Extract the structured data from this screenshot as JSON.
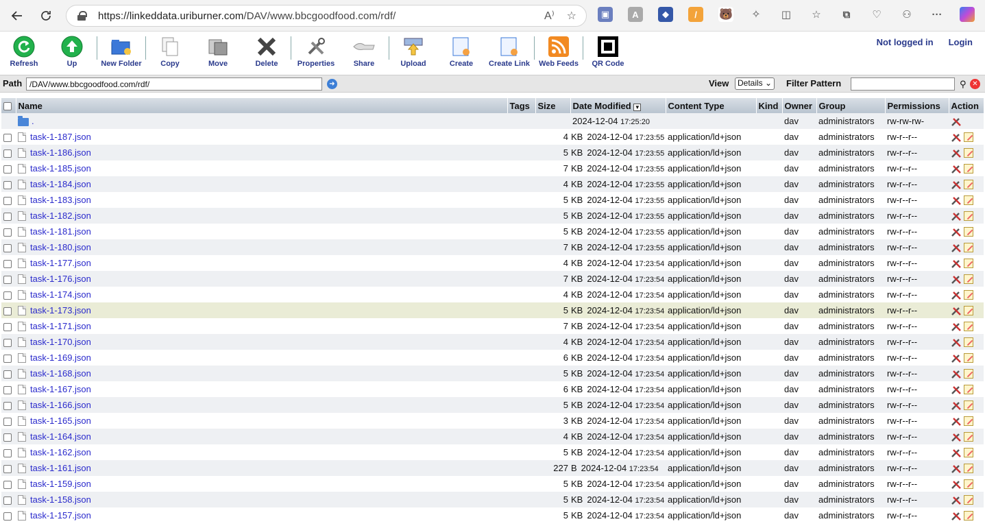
{
  "browser": {
    "url_host": "https://linkeddata.uriburner.com",
    "url_path": "/DAV/www.bbcgoodfood.com/rdf/"
  },
  "toolbar": {
    "items": [
      {
        "label": "Refresh",
        "icon": "refresh-icon"
      },
      {
        "label": "Up",
        "icon": "up-arrow-icon"
      },
      {
        "label": "New Folder",
        "icon": "new-folder-icon"
      },
      {
        "label": "Copy",
        "icon": "copy-icon"
      },
      {
        "label": "Move",
        "icon": "move-icon"
      },
      {
        "label": "Delete",
        "icon": "delete-icon"
      },
      {
        "label": "Properties",
        "icon": "properties-icon"
      },
      {
        "label": "Share",
        "icon": "share-icon"
      },
      {
        "label": "Upload",
        "icon": "upload-icon"
      },
      {
        "label": "Create",
        "icon": "create-icon"
      },
      {
        "label": "Create Link",
        "icon": "create-link-icon"
      },
      {
        "label": "Web Feeds",
        "icon": "rss-icon"
      },
      {
        "label": "QR Code",
        "icon": "qr-code-icon"
      }
    ],
    "login_status": "Not logged in",
    "login_link": "Login"
  },
  "pathbar": {
    "path_label": "Path",
    "path_value": "/DAV/www.bbcgoodfood.com/rdf/",
    "view_label": "View",
    "view_selected": "Details",
    "filter_label": "Filter Pattern",
    "filter_value": ""
  },
  "table": {
    "columns": [
      "Name",
      "Tags",
      "Size",
      "Date Modified",
      "Content Type",
      "Kind",
      "Owner",
      "Group",
      "Permissions",
      "Action"
    ],
    "parent_row": {
      "name": ".",
      "date": "2024-12-04",
      "time": "17:25:20",
      "owner": "dav",
      "group": "administrators",
      "permissions": "rw-rw-rw-"
    },
    "rows": [
      {
        "name": "task-1-187.json",
        "size_n": "4",
        "size_u": "KB",
        "date": "2024-12-04",
        "time": "17:23:55",
        "type": "application/ld+json",
        "owner": "dav",
        "group": "administrators",
        "perm": "rw-r--r--"
      },
      {
        "name": "task-1-186.json",
        "size_n": "5",
        "size_u": "KB",
        "date": "2024-12-04",
        "time": "17:23:55",
        "type": "application/ld+json",
        "owner": "dav",
        "group": "administrators",
        "perm": "rw-r--r--"
      },
      {
        "name": "task-1-185.json",
        "size_n": "7",
        "size_u": "KB",
        "date": "2024-12-04",
        "time": "17:23:55",
        "type": "application/ld+json",
        "owner": "dav",
        "group": "administrators",
        "perm": "rw-r--r--"
      },
      {
        "name": "task-1-184.json",
        "size_n": "4",
        "size_u": "KB",
        "date": "2024-12-04",
        "time": "17:23:55",
        "type": "application/ld+json",
        "owner": "dav",
        "group": "administrators",
        "perm": "rw-r--r--"
      },
      {
        "name": "task-1-183.json",
        "size_n": "5",
        "size_u": "KB",
        "date": "2024-12-04",
        "time": "17:23:55",
        "type": "application/ld+json",
        "owner": "dav",
        "group": "administrators",
        "perm": "rw-r--r--"
      },
      {
        "name": "task-1-182.json",
        "size_n": "5",
        "size_u": "KB",
        "date": "2024-12-04",
        "time": "17:23:55",
        "type": "application/ld+json",
        "owner": "dav",
        "group": "administrators",
        "perm": "rw-r--r--"
      },
      {
        "name": "task-1-181.json",
        "size_n": "5",
        "size_u": "KB",
        "date": "2024-12-04",
        "time": "17:23:55",
        "type": "application/ld+json",
        "owner": "dav",
        "group": "administrators",
        "perm": "rw-r--r--"
      },
      {
        "name": "task-1-180.json",
        "size_n": "7",
        "size_u": "KB",
        "date": "2024-12-04",
        "time": "17:23:55",
        "type": "application/ld+json",
        "owner": "dav",
        "group": "administrators",
        "perm": "rw-r--r--"
      },
      {
        "name": "task-1-177.json",
        "size_n": "4",
        "size_u": "KB",
        "date": "2024-12-04",
        "time": "17:23:54",
        "type": "application/ld+json",
        "owner": "dav",
        "group": "administrators",
        "perm": "rw-r--r--"
      },
      {
        "name": "task-1-176.json",
        "size_n": "7",
        "size_u": "KB",
        "date": "2024-12-04",
        "time": "17:23:54",
        "type": "application/ld+json",
        "owner": "dav",
        "group": "administrators",
        "perm": "rw-r--r--"
      },
      {
        "name": "task-1-174.json",
        "size_n": "4",
        "size_u": "KB",
        "date": "2024-12-04",
        "time": "17:23:54",
        "type": "application/ld+json",
        "owner": "dav",
        "group": "administrators",
        "perm": "rw-r--r--"
      },
      {
        "name": "task-1-173.json",
        "size_n": "5",
        "size_u": "KB",
        "date": "2024-12-04",
        "time": "17:23:54",
        "type": "application/ld+json",
        "owner": "dav",
        "group": "administrators",
        "perm": "rw-r--r--",
        "highlight": true
      },
      {
        "name": "task-1-171.json",
        "size_n": "7",
        "size_u": "KB",
        "date": "2024-12-04",
        "time": "17:23:54",
        "type": "application/ld+json",
        "owner": "dav",
        "group": "administrators",
        "perm": "rw-r--r--"
      },
      {
        "name": "task-1-170.json",
        "size_n": "4",
        "size_u": "KB",
        "date": "2024-12-04",
        "time": "17:23:54",
        "type": "application/ld+json",
        "owner": "dav",
        "group": "administrators",
        "perm": "rw-r--r--"
      },
      {
        "name": "task-1-169.json",
        "size_n": "6",
        "size_u": "KB",
        "date": "2024-12-04",
        "time": "17:23:54",
        "type": "application/ld+json",
        "owner": "dav",
        "group": "administrators",
        "perm": "rw-r--r--"
      },
      {
        "name": "task-1-168.json",
        "size_n": "5",
        "size_u": "KB",
        "date": "2024-12-04",
        "time": "17:23:54",
        "type": "application/ld+json",
        "owner": "dav",
        "group": "administrators",
        "perm": "rw-r--r--"
      },
      {
        "name": "task-1-167.json",
        "size_n": "6",
        "size_u": "KB",
        "date": "2024-12-04",
        "time": "17:23:54",
        "type": "application/ld+json",
        "owner": "dav",
        "group": "administrators",
        "perm": "rw-r--r--"
      },
      {
        "name": "task-1-166.json",
        "size_n": "5",
        "size_u": "KB",
        "date": "2024-12-04",
        "time": "17:23:54",
        "type": "application/ld+json",
        "owner": "dav",
        "group": "administrators",
        "perm": "rw-r--r--"
      },
      {
        "name": "task-1-165.json",
        "size_n": "3",
        "size_u": "KB",
        "date": "2024-12-04",
        "time": "17:23:54",
        "type": "application/ld+json",
        "owner": "dav",
        "group": "administrators",
        "perm": "rw-r--r--"
      },
      {
        "name": "task-1-164.json",
        "size_n": "4",
        "size_u": "KB",
        "date": "2024-12-04",
        "time": "17:23:54",
        "type": "application/ld+json",
        "owner": "dav",
        "group": "administrators",
        "perm": "rw-r--r--"
      },
      {
        "name": "task-1-162.json",
        "size_n": "5",
        "size_u": "KB",
        "date": "2024-12-04",
        "time": "17:23:54",
        "type": "application/ld+json",
        "owner": "dav",
        "group": "administrators",
        "perm": "rw-r--r--"
      },
      {
        "name": "task-1-161.json",
        "size_n": "227",
        "size_u": "B",
        "date": "2024-12-04",
        "time": "17:23:54",
        "type": "application/ld+json",
        "owner": "dav",
        "group": "administrators",
        "perm": "rw-r--r--"
      },
      {
        "name": "task-1-159.json",
        "size_n": "5",
        "size_u": "KB",
        "date": "2024-12-04",
        "time": "17:23:54",
        "type": "application/ld+json",
        "owner": "dav",
        "group": "administrators",
        "perm": "rw-r--r--"
      },
      {
        "name": "task-1-158.json",
        "size_n": "5",
        "size_u": "KB",
        "date": "2024-12-04",
        "time": "17:23:54",
        "type": "application/ld+json",
        "owner": "dav",
        "group": "administrators",
        "perm": "rw-r--r--"
      },
      {
        "name": "task-1-157.json",
        "size_n": "5",
        "size_u": "KB",
        "date": "2024-12-04",
        "time": "17:23:54",
        "type": "application/ld+json",
        "owner": "dav",
        "group": "administrators",
        "perm": "rw-r--r--"
      }
    ]
  }
}
